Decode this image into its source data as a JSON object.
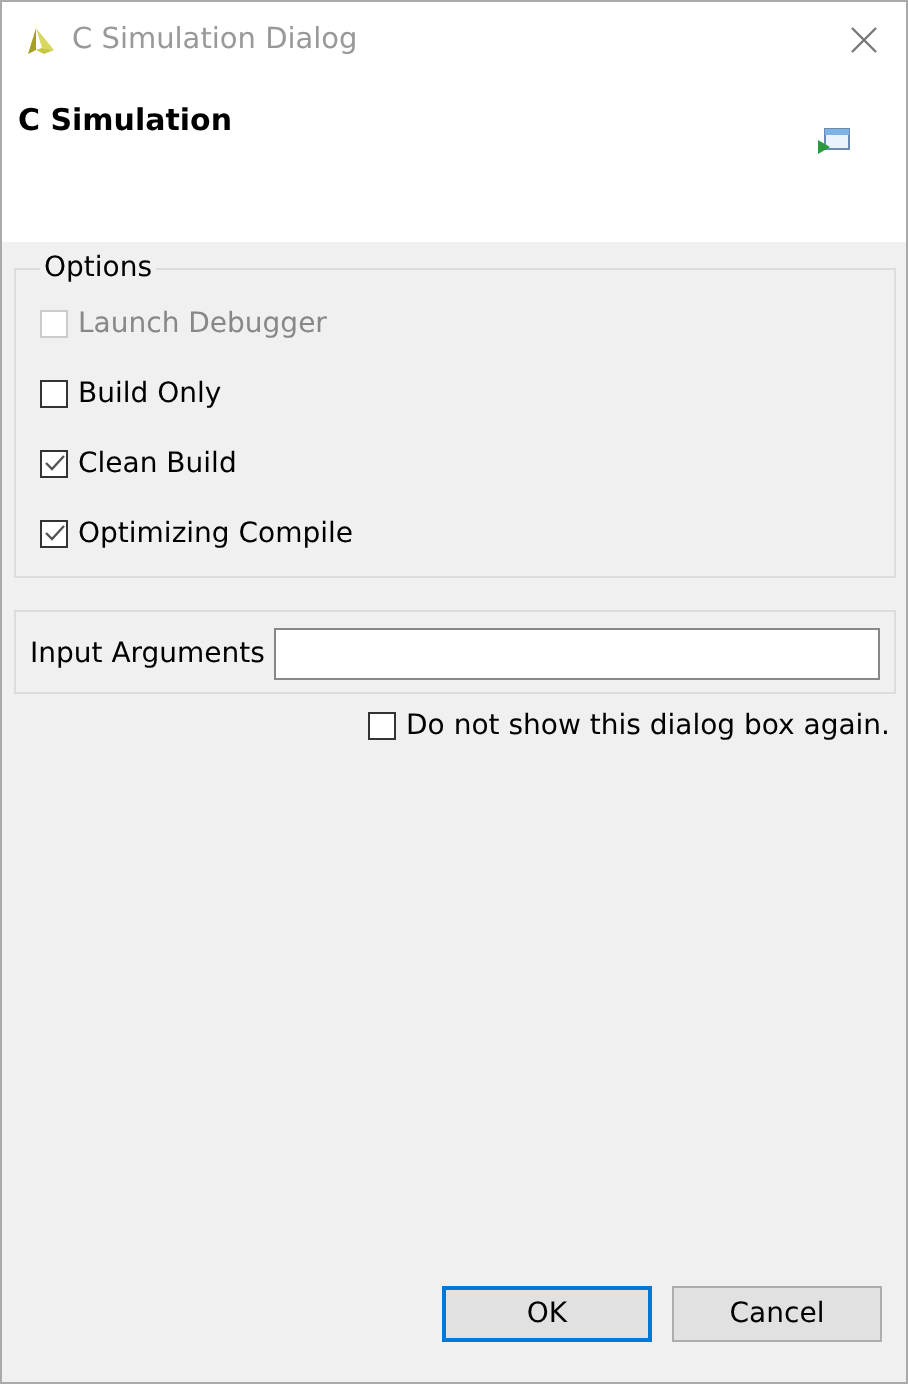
{
  "window": {
    "title": "C Simulation Dialog"
  },
  "header": {
    "title": "C Simulation"
  },
  "options": {
    "legend": "Options",
    "items": [
      {
        "label": "Launch Debugger",
        "checked": false,
        "disabled": true
      },
      {
        "label": "Build Only",
        "checked": false,
        "disabled": false
      },
      {
        "label": "Clean Build",
        "checked": true,
        "disabled": false
      },
      {
        "label": "Optimizing Compile",
        "checked": true,
        "disabled": false
      }
    ]
  },
  "input_arguments": {
    "label": "Input Arguments"
  },
  "dont_show": {
    "label": "Do not show this dialog box again.",
    "checked": false
  },
  "buttons": [
    {
      "label": "OK",
      "default": true
    },
    {
      "label": "Cancel",
      "default": false
    }
  ]
}
